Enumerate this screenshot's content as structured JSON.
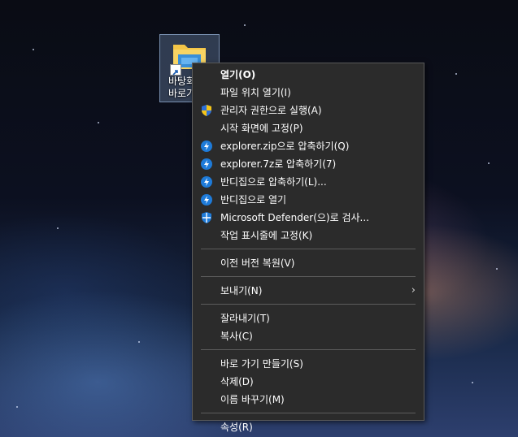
{
  "desktop": {
    "icon": {
      "label": "바탕화\n바로가"
    }
  },
  "menu": {
    "groups": [
      [
        {
          "label": "열기(O)",
          "bold": true,
          "icon": ""
        },
        {
          "label": "파일 위치 열기(I)",
          "icon": ""
        },
        {
          "label": "관리자 권한으로 실행(A)",
          "icon": "uac-shield-icon"
        },
        {
          "label": "시작 화면에 고정(P)",
          "icon": ""
        },
        {
          "label": "explorer.zip으로 압축하기(Q)",
          "icon": "bandizip-icon"
        },
        {
          "label": "explorer.7z로 압축하기(7)",
          "icon": "bandizip-icon"
        },
        {
          "label": "반디집으로 압축하기(L)...",
          "icon": "bandizip-icon"
        },
        {
          "label": "반디집으로 열기",
          "icon": "bandizip-icon"
        },
        {
          "label": "Microsoft Defender(으)로 검사...",
          "icon": "defender-shield-icon"
        },
        {
          "label": "작업 표시줄에 고정(K)",
          "icon": ""
        }
      ],
      [
        {
          "label": "이전 버전 복원(V)",
          "icon": ""
        }
      ],
      [
        {
          "label": "보내기(N)",
          "icon": "",
          "submenu": true
        }
      ],
      [
        {
          "label": "잘라내기(T)",
          "icon": ""
        },
        {
          "label": "복사(C)",
          "icon": ""
        }
      ],
      [
        {
          "label": "바로 가기 만들기(S)",
          "icon": ""
        },
        {
          "label": "삭제(D)",
          "icon": ""
        },
        {
          "label": "이름 바꾸기(M)",
          "icon": ""
        }
      ],
      [
        {
          "label": "속성(R)",
          "icon": ""
        }
      ]
    ],
    "submenu_arrow": "›"
  },
  "colors": {
    "menu_bg": "#2b2b2b",
    "separator": "#5c5c5c",
    "bandizip": "#1e7bd9",
    "defender": "#1e7bd9"
  }
}
